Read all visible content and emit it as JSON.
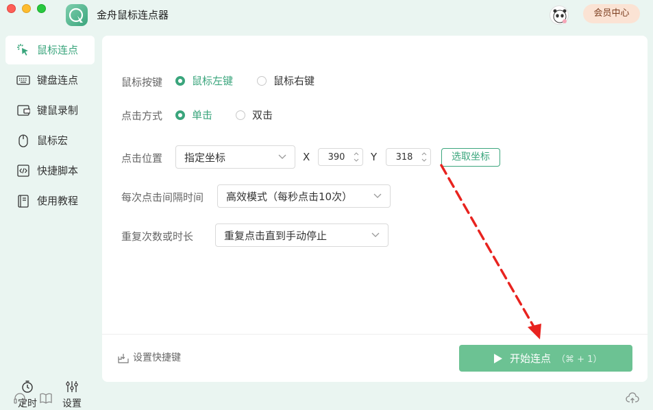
{
  "app": {
    "title": "金舟鼠标连点器",
    "vip_label": "会员中心"
  },
  "sidebar": {
    "items": [
      {
        "label": "鼠标连点",
        "icon": "mouse-click-icon",
        "active": true
      },
      {
        "label": "键盘连点",
        "icon": "keyboard-icon",
        "active": false
      },
      {
        "label": "键鼠录制",
        "icon": "record-icon",
        "active": false
      },
      {
        "label": "鼠标宏",
        "icon": "mouse-icon",
        "active": false
      },
      {
        "label": "快捷脚本",
        "icon": "script-icon",
        "active": false
      },
      {
        "label": "使用教程",
        "icon": "book-icon",
        "active": false
      }
    ],
    "bottom": [
      {
        "label": "定时",
        "icon": "timer-icon"
      },
      {
        "label": "设置",
        "icon": "settings-sliders-icon"
      }
    ]
  },
  "form": {
    "mouse_button": {
      "label": "鼠标按键",
      "options": [
        "鼠标左键",
        "鼠标右键"
      ],
      "selected": "鼠标左键"
    },
    "click_type": {
      "label": "点击方式",
      "options": [
        "单击",
        "双击"
      ],
      "selected": "单击"
    },
    "position": {
      "label": "点击位置",
      "mode": "指定坐标",
      "x_label": "X",
      "x": "390",
      "y_label": "Y",
      "y": "318",
      "pick_label": "选取坐标"
    },
    "interval": {
      "label": "每次点击间隔时间",
      "value": "高效模式（每秒点击10次）"
    },
    "repeat": {
      "label": "重复次数或时长",
      "value": "重复点击直到手动停止"
    }
  },
  "footer": {
    "hotkey_label": "设置快捷键",
    "start_label": "开始连点",
    "start_shortcut": "（⌘ + 1）"
  },
  "colors": {
    "accent": "#3aa57c",
    "start_button": "#6cc293",
    "background": "#eaf5f1",
    "annotation_arrow": "#e8231f"
  }
}
